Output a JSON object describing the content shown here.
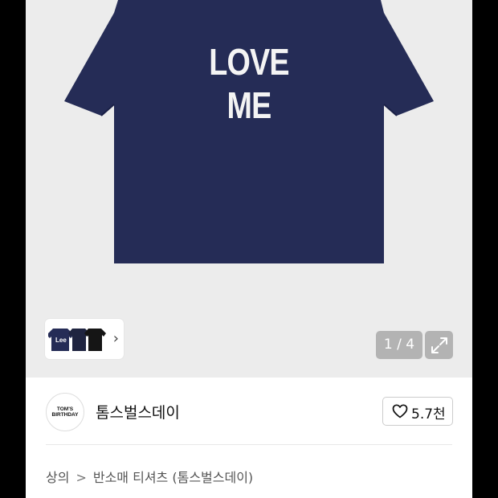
{
  "product_image": {
    "print_text": "LOVE ME",
    "shirt_color": "#252c56",
    "background": "#ececec"
  },
  "thumbnails": {
    "logo_text": "Lee",
    "icon": "chevron-right-icon"
  },
  "gallery": {
    "counter": "1 / 4",
    "expand_icon": "expand-icon"
  },
  "seller": {
    "name": "톰스벌스데이",
    "logo_text_line1": "TOM'S",
    "logo_text_line2": "BIRTHDAY",
    "like_icon": "heart-icon",
    "like_count": "5.7천"
  },
  "breadcrumb": {
    "category": "상의",
    "separator": ">",
    "subcategory": "반소매 티셔츠 (톰스벌스데이)"
  }
}
